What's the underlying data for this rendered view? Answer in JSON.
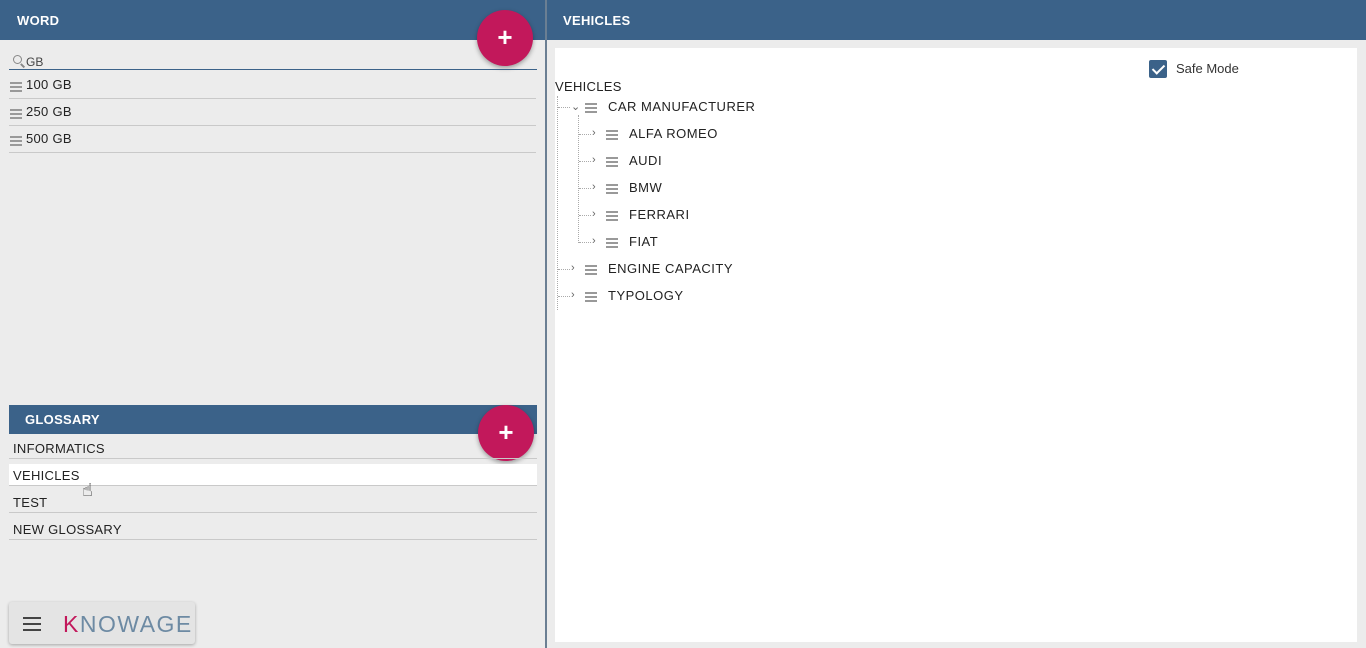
{
  "word_panel": {
    "title": "WORD",
    "add_label": "+",
    "search_value": "GB",
    "items": [
      {
        "label": "100 GB"
      },
      {
        "label": "250 GB"
      },
      {
        "label": "500 GB"
      }
    ]
  },
  "glossary_panel": {
    "title": "GLOSSARY",
    "add_label": "+",
    "items": [
      {
        "label": "INFORMATICS"
      },
      {
        "label": "VEHICLES"
      },
      {
        "label": "TEST"
      },
      {
        "label": "NEW GLOSSARY"
      }
    ]
  },
  "brand": {
    "logo_k": "K",
    "logo_rest": "NOWAGE"
  },
  "vehicles_panel": {
    "title": "VEHICLES",
    "safe_mode_label": "Safe Mode",
    "safe_mode_checked": true,
    "tree": {
      "root": "VEHICLES",
      "nodes": [
        {
          "label": "CAR MANUFACTURER",
          "expanded": true,
          "children": [
            {
              "label": "ALFA ROMEO"
            },
            {
              "label": "AUDI"
            },
            {
              "label": "BMW"
            },
            {
              "label": "FERRARI"
            },
            {
              "label": "FIAT"
            }
          ]
        },
        {
          "label": "ENGINE CAPACITY",
          "expanded": false
        },
        {
          "label": "TYPOLOGY",
          "expanded": false
        }
      ]
    }
  },
  "colors": {
    "header": "#3b6289",
    "accent": "#c2185b",
    "panel_bg": "#ececec"
  },
  "icons": {
    "expanded": "chevron-down-icon",
    "collapsed": "chevron-right-icon",
    "item": "menu-icon",
    "search": "search-icon"
  }
}
